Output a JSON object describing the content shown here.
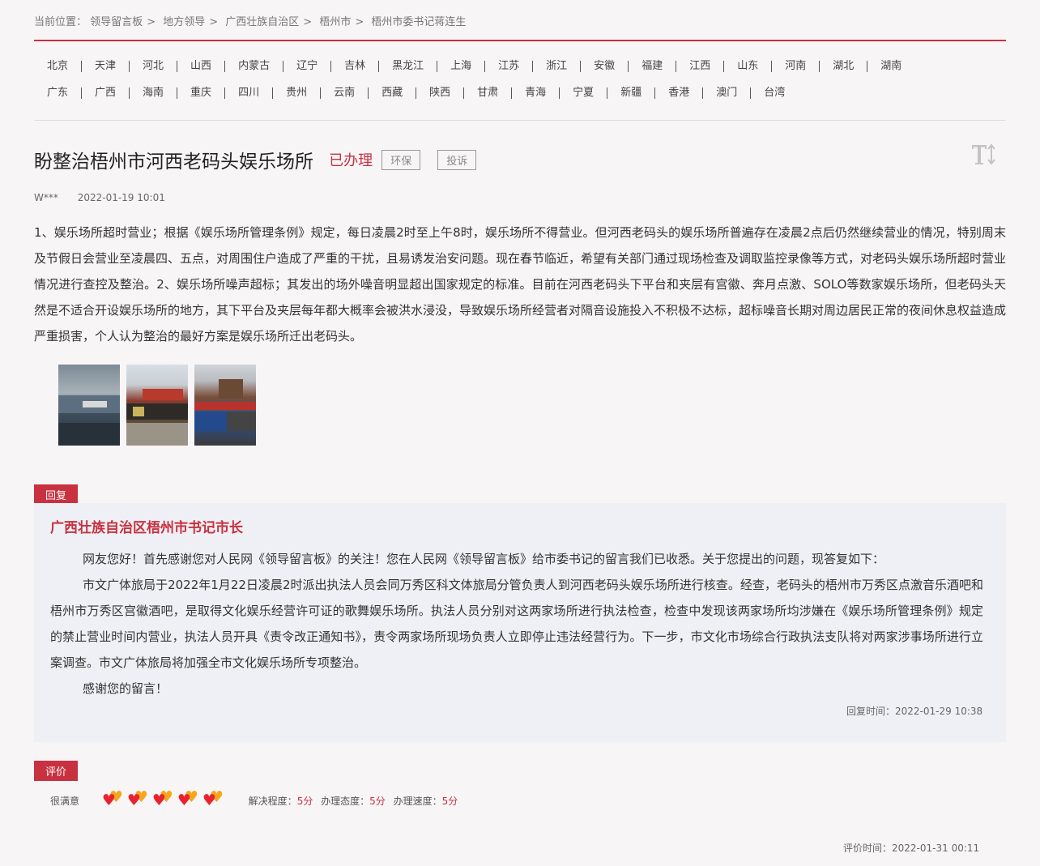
{
  "breadcrumb": {
    "prefix": "当前位置：",
    "items": [
      "领导留言板",
      "地方领导",
      "广西壮族自治区",
      "梧州市",
      "梧州市委书记蒋连生"
    ],
    "separator": ">"
  },
  "regions": {
    "row1": [
      "北京",
      "天津",
      "河北",
      "山西",
      "内蒙古",
      "辽宁",
      "吉林",
      "黑龙江",
      "上海",
      "江苏",
      "浙江",
      "安徽",
      "福建",
      "江西",
      "山东",
      "河南",
      "湖北",
      "湖南"
    ],
    "row2": [
      "广东",
      "广西",
      "海南",
      "重庆",
      "四川",
      "贵州",
      "云南",
      "西藏",
      "陕西",
      "甘肃",
      "青海",
      "宁夏",
      "新疆",
      "香港",
      "澳门",
      "台湾"
    ]
  },
  "message": {
    "title": "盼整治梧州市河西老码头娱乐场所",
    "status": "已办理",
    "tags": [
      "环保",
      "投诉"
    ],
    "author": "W***",
    "time": "2022-01-19 10:01",
    "body": "1、娱乐场所超时营业；根据《娱乐场所管理条例》规定，每日凌晨2时至上午8时，娱乐场所不得营业。但河西老码头的娱乐场所普遍存在凌晨2点后仍然继续营业的情况，特别周末及节假日会营业至凌晨四、五点，对周围住户造成了严重的干扰，且易诱发治安问题。现在春节临近，希望有关部门通过现场检查及调取监控录像等方式，对老码头娱乐场所超时营业情况进行查控及整治。2、娱乐场所噪声超标；其发出的场外噪音明显超出国家规定的标准。目前在河西老码头下平台和夹层有宫徽、奔月点激、SOLO等数家娱乐场所，但老码头天然是不适合开设娱乐场所的地方，其下平台及夹层每年都大概率会被洪水浸没，导致娱乐场所经营者对隔音设施投入不积极不达标，超标噪音长期对周边居民正常的夜间休息权益造成严重损害，个人认为整治的最好方案是娱乐场所迁出老码头。"
  },
  "reply": {
    "badge": "回复",
    "org": "广西壮族自治区梧州市书记市长",
    "paragraphs": [
      "网友您好！首先感谢您对人民网《领导留言板》的关注！您在人民网《领导留言板》给市委书记的留言我们已收悉。关于您提出的问题，现答复如下：",
      "市文广体旅局于2022年1月22日凌晨2时派出执法人员会同万秀区科文体旅局分管负责人到河西老码头娱乐场所进行核查。经查，老码头的梧州市万秀区点激音乐酒吧和梧州市万秀区宫徽酒吧，是取得文化娱乐经营许可证的歌舞娱乐场所。执法人员分别对这两家场所进行执法检查，检查中发现该两家场所均涉嫌在《娱乐场所管理条例》规定的禁止营业时间内营业，执法人员开具《责令改正通知书》，责令两家场所现场负责人立即停止违法经营行为。下一步，市文化市场综合行政执法支队将对两家涉事场所进行立案调查。市文广体旅局将加强全市文化娱乐场所专项整治。",
      "感谢您的留言！"
    ],
    "time_label": "回复时间：",
    "time": "2022-01-29 10:38"
  },
  "evaluation": {
    "badge": "评价",
    "rating_label": "很满意",
    "hearts": 5,
    "scores": [
      {
        "label": "解决程度：",
        "value": "5分"
      },
      {
        "label": "办理态度：",
        "value": "5分"
      },
      {
        "label": "办理速度：",
        "value": "5分"
      }
    ],
    "time_label": "评价时间：",
    "time": "2022-01-31 00:11"
  },
  "colors": {
    "accent": "#c8313f",
    "heart_red": "#e8232f",
    "heart_orange": "#f6a71b"
  }
}
